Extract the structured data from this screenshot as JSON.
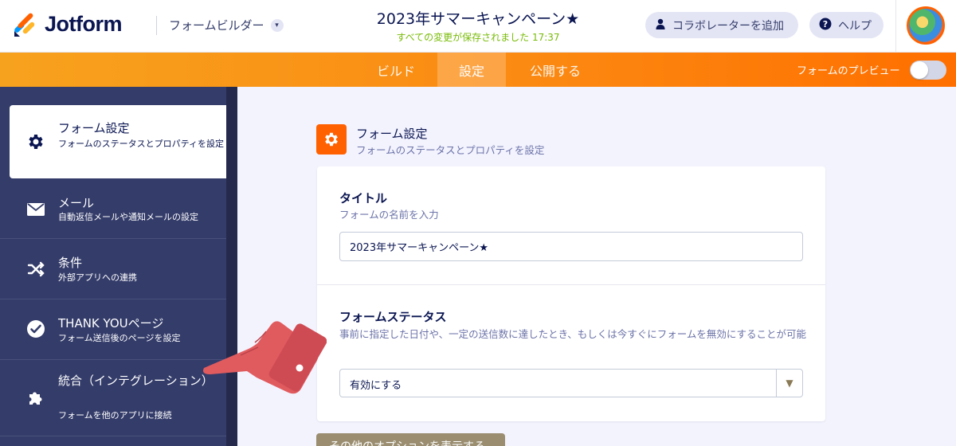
{
  "header": {
    "logo_text": "Jotform",
    "builder_dropdown": "フォームビルダー",
    "form_title": "2023年サマーキャンペーン★",
    "save_status": "すべての変更が保存されました 17:37",
    "collab_button": "コラボレーターを追加",
    "help_button": "ヘルプ"
  },
  "tabs": {
    "build": "ビルド",
    "settings": "設定",
    "publish": "公開する",
    "preview_label": "フォームのプレビュー"
  },
  "sidebar": {
    "items": [
      {
        "title": "フォーム設定",
        "sub": "フォームのステータスとプロパティを設定",
        "icon": "gear-icon"
      },
      {
        "title": "メール",
        "sub": "自動返信メールや通知メールの設定",
        "icon": "envelope-icon"
      },
      {
        "title": "条件",
        "sub": "外部アプリへの連携",
        "icon": "shuffle-icon"
      },
      {
        "title": "THANK YOUページ",
        "sub": "フォーム送信後のページを設定",
        "icon": "check-circle-icon"
      },
      {
        "title": "統合（インテグレーション）",
        "sub": "フォームを他のアプリに接続",
        "icon": "puzzle-icon"
      }
    ]
  },
  "section": {
    "title": "フォーム設定",
    "subtitle": "フォームのステータスとプロパティを設定"
  },
  "title_field": {
    "label": "タイトル",
    "help": "フォームの名前を入力",
    "value": "2023年サマーキャンペーン★"
  },
  "status_field": {
    "label": "フォームステータス",
    "help": "事前に指定した日付や、一定の送信数に達したとき、もしくは今すぐにフォームを無効にすることが可能",
    "value": "有効にする"
  },
  "more_options_button": "その他のオプションを表示する",
  "colors": {
    "accent": "#ff6100",
    "sidebar": "#343c6a",
    "saved_text": "#78bb07"
  }
}
